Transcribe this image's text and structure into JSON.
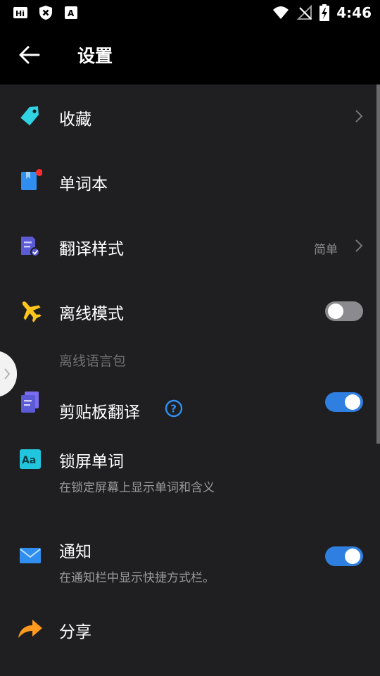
{
  "status_bar": {
    "time": "4:46",
    "left_icons": [
      "hi-app-icon",
      "shield-x-icon",
      "a-app-icon"
    ],
    "right_icons": [
      "wifi-icon",
      "no-signal-icon",
      "battery-charging-icon"
    ]
  },
  "header": {
    "title": "设置",
    "back_icon": "arrow-left-icon"
  },
  "items": [
    {
      "id": "favorites",
      "label": "收藏",
      "icon": "tag-icon",
      "icon_color": "#2fd3e4",
      "control": "chevron"
    },
    {
      "id": "wordbook",
      "label": "单词本",
      "icon": "bookmark-book-icon",
      "icon_color": "#2f8ef0",
      "badge_color": "#ff2d2d"
    },
    {
      "id": "translate-style",
      "label": "翻译样式",
      "icon": "document-check-icon",
      "icon_color": "#5b5bd6",
      "value": "简单",
      "control": "chevron"
    },
    {
      "id": "offline",
      "label": "离线模式",
      "icon": "airplane-icon",
      "icon_color": "#ffc51a",
      "toggle": false
    },
    {
      "id": "offline-pack",
      "section_label": "离线语言包"
    },
    {
      "id": "clipboard",
      "label": "剪贴板翻译",
      "icon": "clipboard-icon",
      "icon_color": "#5b5bd6",
      "help_icon": "question-circle-icon",
      "toggle": true
    },
    {
      "id": "lockscreen",
      "label": "锁屏单词",
      "subtitle": "在锁定屏幕上显示单词和含义",
      "icon": "aa-icon",
      "icon_color": "#21c6de",
      "icon_text": "Aa"
    },
    {
      "id": "notification",
      "label": "通知",
      "subtitle": "在通知栏中显示快捷方式栏。",
      "icon": "envelope-icon",
      "icon_color": "#2f8ef0",
      "toggle": true
    },
    {
      "id": "share",
      "label": "分享",
      "icon": "share-arrow-icon",
      "icon_color": "#ff9a1f"
    }
  ],
  "colors": {
    "accent": "#2f7fe0",
    "background": "#1f1f21",
    "appbar": "#000000"
  }
}
